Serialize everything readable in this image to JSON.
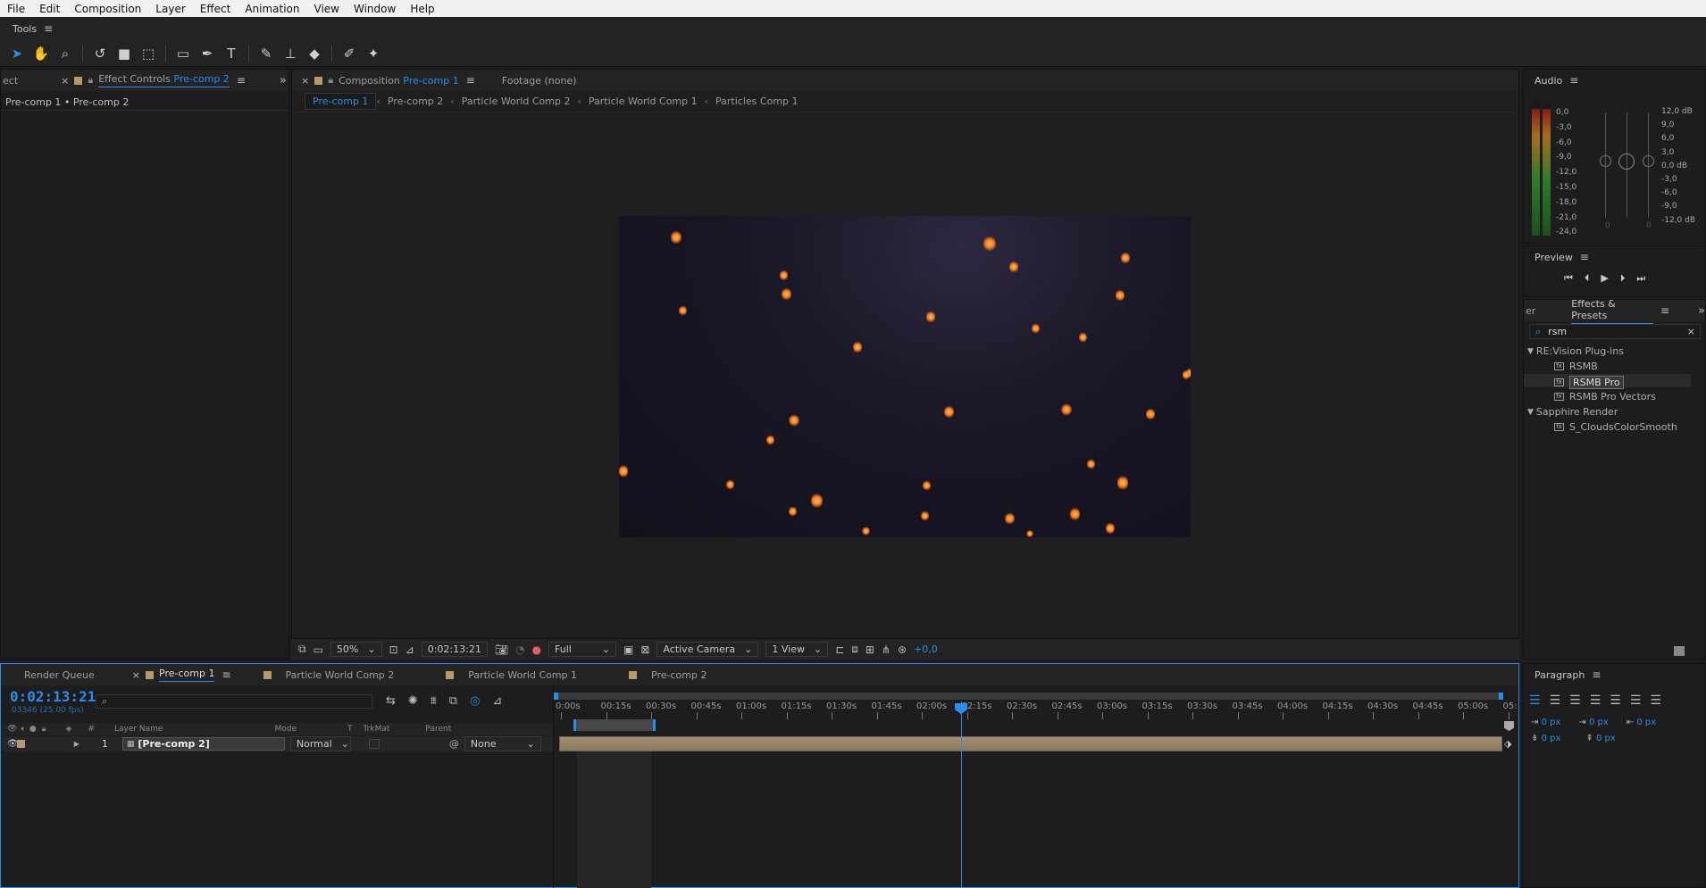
{
  "menubar": {
    "items": [
      "File",
      "Edit",
      "Composition",
      "Layer",
      "Effect",
      "Animation",
      "View",
      "Window",
      "Help"
    ]
  },
  "tools": {
    "title": "Tools",
    "icons": [
      "selection-icon",
      "hand-icon",
      "zoom-icon",
      "rotate-icon",
      "camera-icon",
      "pan-behind-icon",
      "rectangle-icon",
      "pen-icon",
      "text-icon",
      "brush-icon",
      "clone-stamp-icon",
      "eraser-icon",
      "roto-brush-icon",
      "puppet-pin-icon"
    ]
  },
  "effect_controls": {
    "tab_prefix": "ect",
    "tab_label": "Effect Controls",
    "tab_comp": "Pre-comp 2",
    "breadcrumb": "Pre-comp 1 • Pre-comp 2"
  },
  "composition": {
    "tab_label": "Composition",
    "tab_comp": "Pre-comp 1",
    "footage_label": "Footage (none)",
    "breadcrumbs": [
      "Pre-comp 1",
      "Pre-comp 2",
      "Particle World Comp 2",
      "Particle World Comp 1",
      "Particles Comp 1"
    ]
  },
  "viewer_footer": {
    "zoom": "50%",
    "timecode": "0:02:13:21",
    "resolution": "Full",
    "camera": "Active Camera",
    "views": "1 View",
    "exposure": "+0,0"
  },
  "audio": {
    "title": "Audio",
    "left_scale": [
      "0,0",
      "-3,0",
      "-6,0",
      "-9,0",
      "-12,0",
      "-15,0",
      "-18,0",
      "-21,0",
      "-24,0"
    ],
    "right_scale": [
      "12,0 dB",
      "9,0",
      "6,0",
      "3,0",
      "0,0 dB",
      "-3,0",
      "-6,0",
      "-9,0",
      "-12,0 dB"
    ],
    "slider_zero_left": "0",
    "slider_zero_right": "0"
  },
  "preview": {
    "title": "Preview"
  },
  "effects_presets": {
    "prev_tab": "er",
    "title": "Effects & Presets",
    "search_value": "rsm",
    "groups": [
      {
        "name": "RE:Vision Plug-ins",
        "items": [
          "RSMB",
          "RSMB Pro",
          "RSMB Pro Vectors"
        ]
      },
      {
        "name": "Sapphire Render",
        "items": [
          "S_CloudsColorSmooth"
        ]
      }
    ],
    "selected_item": "RSMB Pro"
  },
  "timeline": {
    "tabs": [
      "Render Queue",
      "Pre-comp 1",
      "Particle World Comp 2",
      "Particle World Comp 1",
      "Pre-comp 2"
    ],
    "active_tab": "Pre-comp 1",
    "timecode": "0:02:13:21",
    "frame_info": "03346 (25.00 fps)",
    "columns": {
      "num": "#",
      "layer_name": "Layer Name",
      "mode": "Mode",
      "t": "T",
      "trkmat": "TrkMat",
      "parent": "Parent"
    },
    "layers": [
      {
        "num": "1",
        "name": "[Pre-comp 2]",
        "mode": "Normal",
        "parent": "None"
      }
    ],
    "ruler": [
      "0:00s",
      "00:15s",
      "00:30s",
      "00:45s",
      "01:00s",
      "01:15s",
      "01:30s",
      "01:45s",
      "02:00s",
      "02:15s",
      "02:30s",
      "02:45s",
      "03:00s",
      "03:15s",
      "03:30s",
      "03:45s",
      "04:00s",
      "04:15s",
      "04:30s",
      "04:45s",
      "05:00s",
      "05:"
    ]
  },
  "paragraph": {
    "title": "Paragraph",
    "indent_left": "0 px",
    "indent_first": "0 px",
    "indent_right": "0 px",
    "space_before": "0 px",
    "space_after": "0 px"
  },
  "colors": {
    "accent": "#2d8ceb",
    "label_swatch": "#b59a6e",
    "layer_bar": "#a08a66"
  }
}
